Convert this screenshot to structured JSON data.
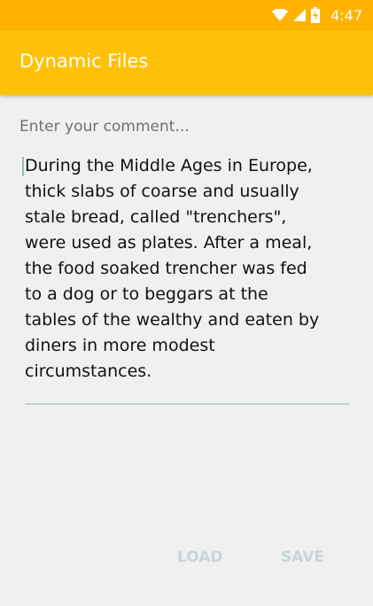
{
  "status_bar": {
    "time": "4:47",
    "icons": [
      "wifi-icon",
      "cellular-signal-icon",
      "battery-charging-icon"
    ]
  },
  "app_bar": {
    "title": "Dynamic Files",
    "color": "#ffc107"
  },
  "comment": {
    "label": "Enter your comment...",
    "text": "During the Middle Ages in Europe,\nthick slabs of coarse and usually\nstale bread, called \"trenchers\",\nwere used as plates. After a meal,\nthe food soaked trencher was fed\nto a dog or to beggars at the\ntables of the wealthy and eaten by\ndiners in more modest\ncircumstances."
  },
  "buttons": {
    "load_label": "LOAD",
    "save_label": "SAVE",
    "disabled_color": "#c8d5d9"
  }
}
